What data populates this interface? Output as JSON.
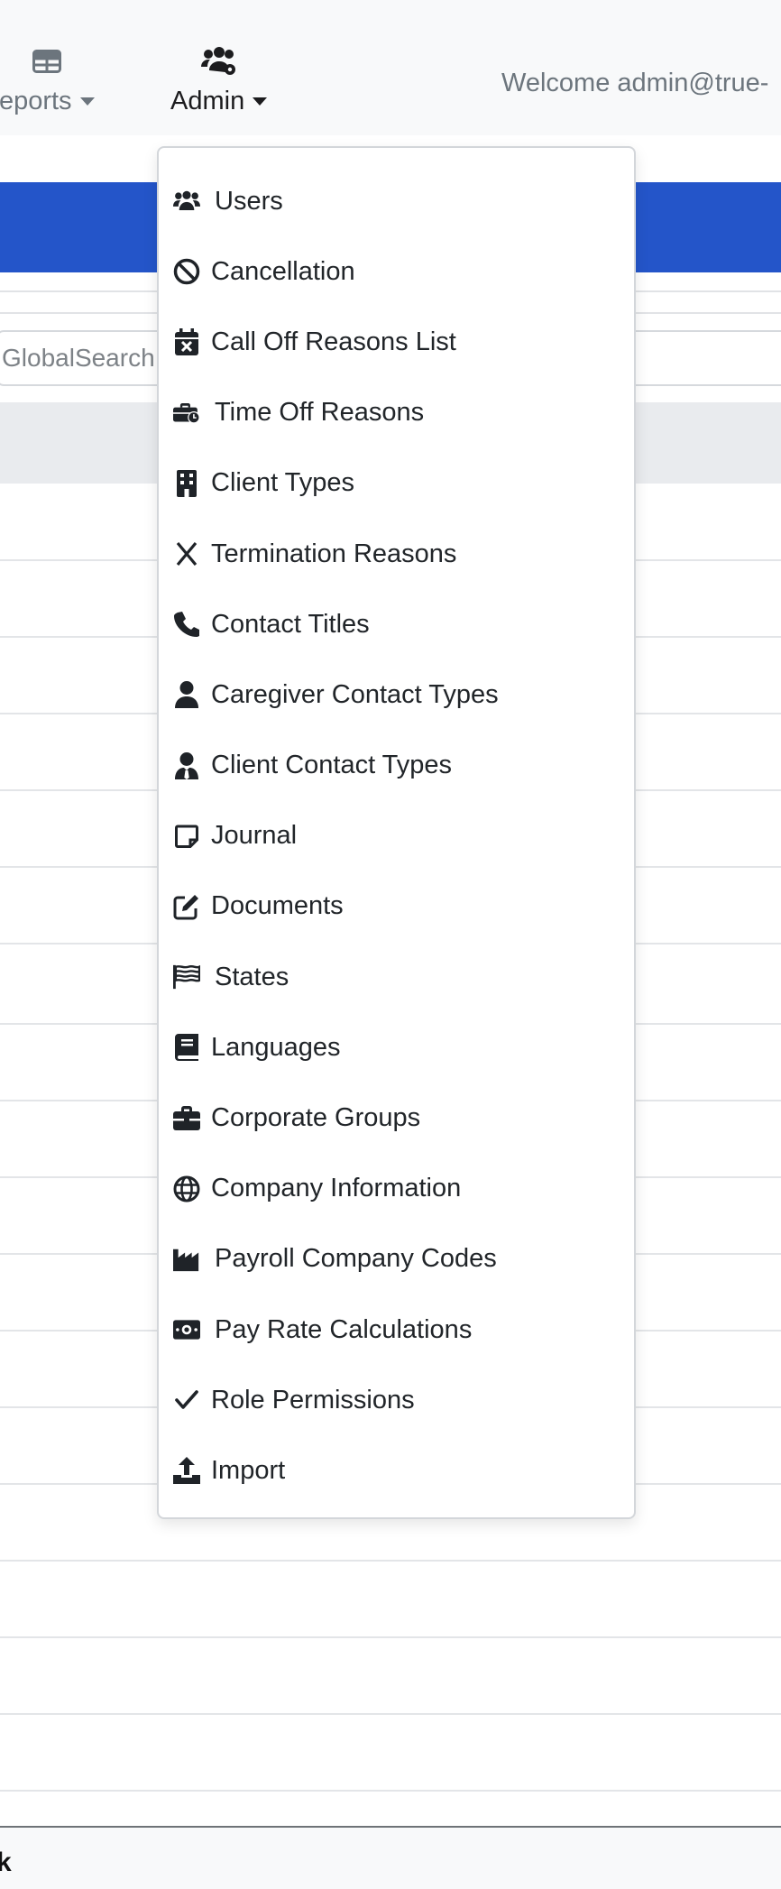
{
  "nav": {
    "reports_label": "Reports",
    "admin_label": "Admin",
    "welcome_text": "Welcome admin@true-"
  },
  "search": {
    "placeholder": "GlobalSearch"
  },
  "admin_menu": [
    {
      "label": "Users",
      "icon": "users-icon"
    },
    {
      "label": "Cancellation",
      "icon": "ban-icon"
    },
    {
      "label": "Call Off Reasons List",
      "icon": "calendar-x-icon"
    },
    {
      "label": "Time Off Reasons",
      "icon": "briefcase-clock-icon"
    },
    {
      "label": "Client Types",
      "icon": "building-icon"
    },
    {
      "label": "Termination Reasons",
      "icon": "x-icon"
    },
    {
      "label": "Contact Titles",
      "icon": "phone-icon"
    },
    {
      "label": "Caregiver Contact Types",
      "icon": "user-icon"
    },
    {
      "label": "Client Contact Types",
      "icon": "user-tie-icon"
    },
    {
      "label": "Journal",
      "icon": "note-icon"
    },
    {
      "label": "Documents",
      "icon": "pen-to-square-icon"
    },
    {
      "label": "States",
      "icon": "flag-icon"
    },
    {
      "label": "Languages",
      "icon": "book-icon"
    },
    {
      "label": "Corporate Groups",
      "icon": "briefcase-icon"
    },
    {
      "label": "Company Information",
      "icon": "globe-icon"
    },
    {
      "label": "Payroll Company Codes",
      "icon": "industry-icon"
    },
    {
      "label": "Pay Rate Calculations",
      "icon": "money-bill-icon"
    },
    {
      "label": "Role Permissions",
      "icon": "check-icon"
    },
    {
      "label": "Import",
      "icon": "upload-icon"
    }
  ],
  "footer": {
    "text": "k"
  },
  "colors": {
    "accent_band": "#2455c9",
    "nav_bg": "#f8f9fa"
  }
}
